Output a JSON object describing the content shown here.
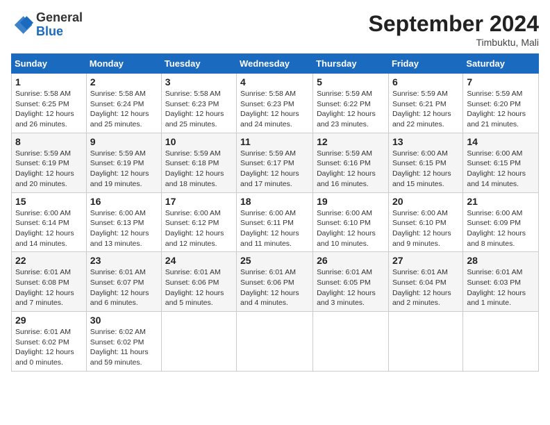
{
  "logo": {
    "general": "General",
    "blue": "Blue"
  },
  "title": "September 2024",
  "location": "Timbuktu, Mali",
  "days_of_week": [
    "Sunday",
    "Monday",
    "Tuesday",
    "Wednesday",
    "Thursday",
    "Friday",
    "Saturday"
  ],
  "weeks": [
    [
      {
        "day": "1",
        "info": "Sunrise: 5:58 AM\nSunset: 6:25 PM\nDaylight: 12 hours\nand 26 minutes."
      },
      {
        "day": "2",
        "info": "Sunrise: 5:58 AM\nSunset: 6:24 PM\nDaylight: 12 hours\nand 25 minutes."
      },
      {
        "day": "3",
        "info": "Sunrise: 5:58 AM\nSunset: 6:23 PM\nDaylight: 12 hours\nand 25 minutes."
      },
      {
        "day": "4",
        "info": "Sunrise: 5:58 AM\nSunset: 6:23 PM\nDaylight: 12 hours\nand 24 minutes."
      },
      {
        "day": "5",
        "info": "Sunrise: 5:59 AM\nSunset: 6:22 PM\nDaylight: 12 hours\nand 23 minutes."
      },
      {
        "day": "6",
        "info": "Sunrise: 5:59 AM\nSunset: 6:21 PM\nDaylight: 12 hours\nand 22 minutes."
      },
      {
        "day": "7",
        "info": "Sunrise: 5:59 AM\nSunset: 6:20 PM\nDaylight: 12 hours\nand 21 minutes."
      }
    ],
    [
      {
        "day": "8",
        "info": "Sunrise: 5:59 AM\nSunset: 6:19 PM\nDaylight: 12 hours\nand 20 minutes."
      },
      {
        "day": "9",
        "info": "Sunrise: 5:59 AM\nSunset: 6:19 PM\nDaylight: 12 hours\nand 19 minutes."
      },
      {
        "day": "10",
        "info": "Sunrise: 5:59 AM\nSunset: 6:18 PM\nDaylight: 12 hours\nand 18 minutes."
      },
      {
        "day": "11",
        "info": "Sunrise: 5:59 AM\nSunset: 6:17 PM\nDaylight: 12 hours\nand 17 minutes."
      },
      {
        "day": "12",
        "info": "Sunrise: 5:59 AM\nSunset: 6:16 PM\nDaylight: 12 hours\nand 16 minutes."
      },
      {
        "day": "13",
        "info": "Sunrise: 6:00 AM\nSunset: 6:15 PM\nDaylight: 12 hours\nand 15 minutes."
      },
      {
        "day": "14",
        "info": "Sunrise: 6:00 AM\nSunset: 6:15 PM\nDaylight: 12 hours\nand 14 minutes."
      }
    ],
    [
      {
        "day": "15",
        "info": "Sunrise: 6:00 AM\nSunset: 6:14 PM\nDaylight: 12 hours\nand 14 minutes."
      },
      {
        "day": "16",
        "info": "Sunrise: 6:00 AM\nSunset: 6:13 PM\nDaylight: 12 hours\nand 13 minutes."
      },
      {
        "day": "17",
        "info": "Sunrise: 6:00 AM\nSunset: 6:12 PM\nDaylight: 12 hours\nand 12 minutes."
      },
      {
        "day": "18",
        "info": "Sunrise: 6:00 AM\nSunset: 6:11 PM\nDaylight: 12 hours\nand 11 minutes."
      },
      {
        "day": "19",
        "info": "Sunrise: 6:00 AM\nSunset: 6:10 PM\nDaylight: 12 hours\nand 10 minutes."
      },
      {
        "day": "20",
        "info": "Sunrise: 6:00 AM\nSunset: 6:10 PM\nDaylight: 12 hours\nand 9 minutes."
      },
      {
        "day": "21",
        "info": "Sunrise: 6:00 AM\nSunset: 6:09 PM\nDaylight: 12 hours\nand 8 minutes."
      }
    ],
    [
      {
        "day": "22",
        "info": "Sunrise: 6:01 AM\nSunset: 6:08 PM\nDaylight: 12 hours\nand 7 minutes."
      },
      {
        "day": "23",
        "info": "Sunrise: 6:01 AM\nSunset: 6:07 PM\nDaylight: 12 hours\nand 6 minutes."
      },
      {
        "day": "24",
        "info": "Sunrise: 6:01 AM\nSunset: 6:06 PM\nDaylight: 12 hours\nand 5 minutes."
      },
      {
        "day": "25",
        "info": "Sunrise: 6:01 AM\nSunset: 6:06 PM\nDaylight: 12 hours\nand 4 minutes."
      },
      {
        "day": "26",
        "info": "Sunrise: 6:01 AM\nSunset: 6:05 PM\nDaylight: 12 hours\nand 3 minutes."
      },
      {
        "day": "27",
        "info": "Sunrise: 6:01 AM\nSunset: 6:04 PM\nDaylight: 12 hours\nand 2 minutes."
      },
      {
        "day": "28",
        "info": "Sunrise: 6:01 AM\nSunset: 6:03 PM\nDaylight: 12 hours\nand 1 minute."
      }
    ],
    [
      {
        "day": "29",
        "info": "Sunrise: 6:01 AM\nSunset: 6:02 PM\nDaylight: 12 hours\nand 0 minutes."
      },
      {
        "day": "30",
        "info": "Sunrise: 6:02 AM\nSunset: 6:02 PM\nDaylight: 11 hours\nand 59 minutes."
      },
      {
        "day": "",
        "info": ""
      },
      {
        "day": "",
        "info": ""
      },
      {
        "day": "",
        "info": ""
      },
      {
        "day": "",
        "info": ""
      },
      {
        "day": "",
        "info": ""
      }
    ]
  ]
}
